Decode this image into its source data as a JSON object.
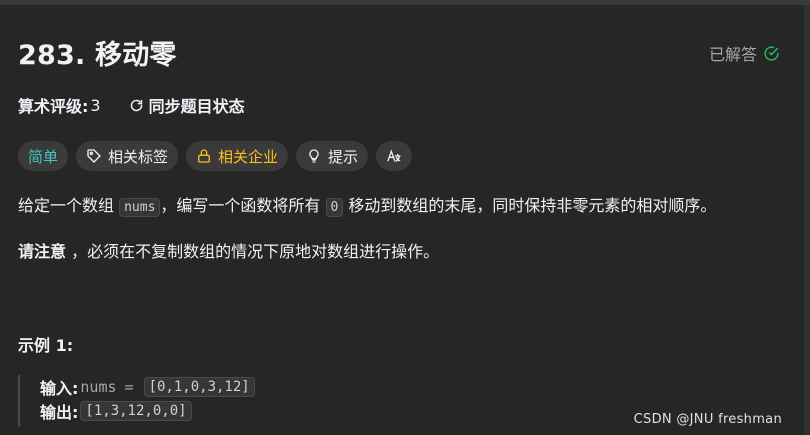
{
  "problem": {
    "title": "283. 移动零",
    "solved_label": "已解答"
  },
  "meta": {
    "rating_label": "算术评级:",
    "rating_value": "3",
    "sync_label": "同步题目状态"
  },
  "tags": {
    "difficulty": "简单",
    "topics": "相关标签",
    "companies": "相关企业",
    "hint": "提示"
  },
  "description": {
    "part1": "给定一个数组 ",
    "code1": "nums",
    "part2": "，编写一个函数将所有 ",
    "code2": "0",
    "part3": " 移动到数组的末尾，同时保持非零元素的相对顺序。",
    "note_bold": "请注意",
    "note_rest": " ，必须在不复制数组的情况下原地对数组进行操作。"
  },
  "example": {
    "title": "示例 1:",
    "input_label": "输入:",
    "input_var": "nums",
    "input_eq": "=",
    "input_value": "[0,1,0,3,12]",
    "output_label": "输出:",
    "output_value": "[1,3,12,0,0]"
  },
  "watermark": "CSDN @JNU freshman",
  "colors": {
    "background": "#262626",
    "easy": "#46c6c2",
    "company": "#ffc01e",
    "solved_check": "#2cbb5d"
  }
}
